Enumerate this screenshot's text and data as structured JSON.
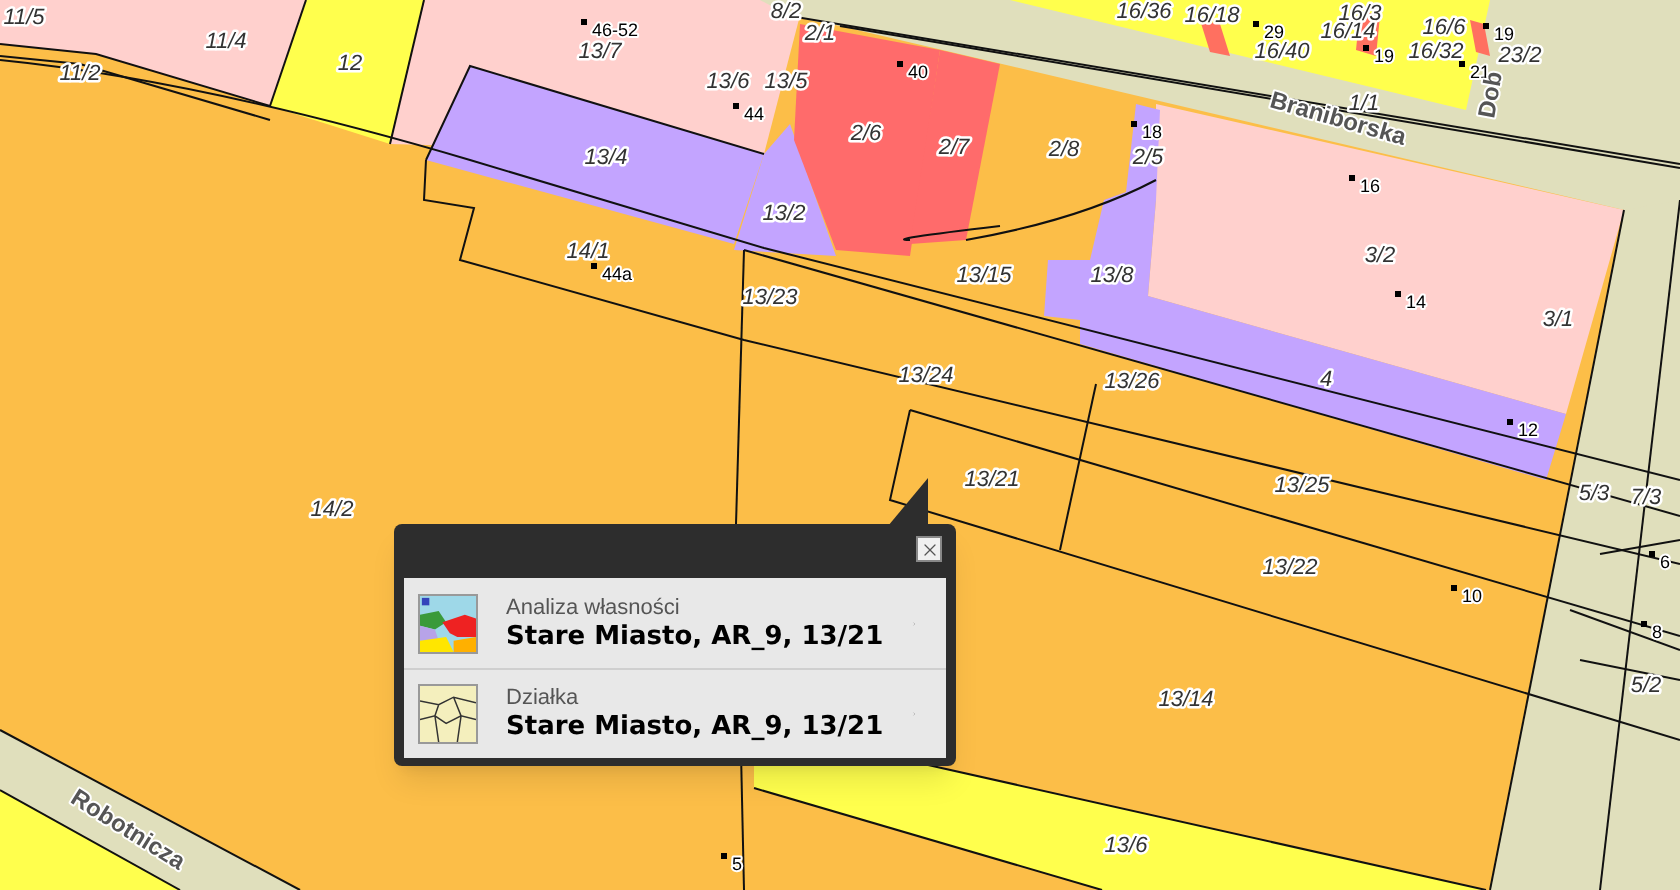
{
  "map": {
    "parcels": [
      "11/5",
      "11/4",
      "11/2",
      "12",
      "13/7",
      "8/2",
      "2/1",
      "13/6",
      "13/5",
      "13/4",
      "2/6",
      "2/7",
      "2/8",
      "2/5",
      "13/2",
      "14/1",
      "13/23",
      "13/15",
      "13/8",
      "1/1",
      "16/36",
      "16/18",
      "16/3",
      "16/14",
      "16/40",
      "16/6",
      "16/32",
      "23/2",
      "3/2",
      "3/1",
      "13/24",
      "13/26",
      "4",
      "13/21",
      "13/25",
      "13/22",
      "5/3",
      "7/3",
      "14/2",
      "13/14",
      "5/2",
      "13/6"
    ],
    "house_numbers": [
      "46-52",
      "44",
      "40",
      "18",
      "44a",
      "29",
      "19",
      "19",
      "21",
      "16",
      "14",
      "12",
      "10",
      "6",
      "8",
      "5"
    ],
    "streets": [
      "Braniborska",
      "Dob",
      "Robotnicza"
    ]
  },
  "popup": {
    "items": [
      {
        "kind": "ownership",
        "category": "Analiza własności",
        "title": "Stare Miasto, AR_9, 13/21"
      },
      {
        "kind": "parcel",
        "category": "Działka",
        "title": "Stare Miasto, AR_9, 13/21"
      }
    ]
  }
}
